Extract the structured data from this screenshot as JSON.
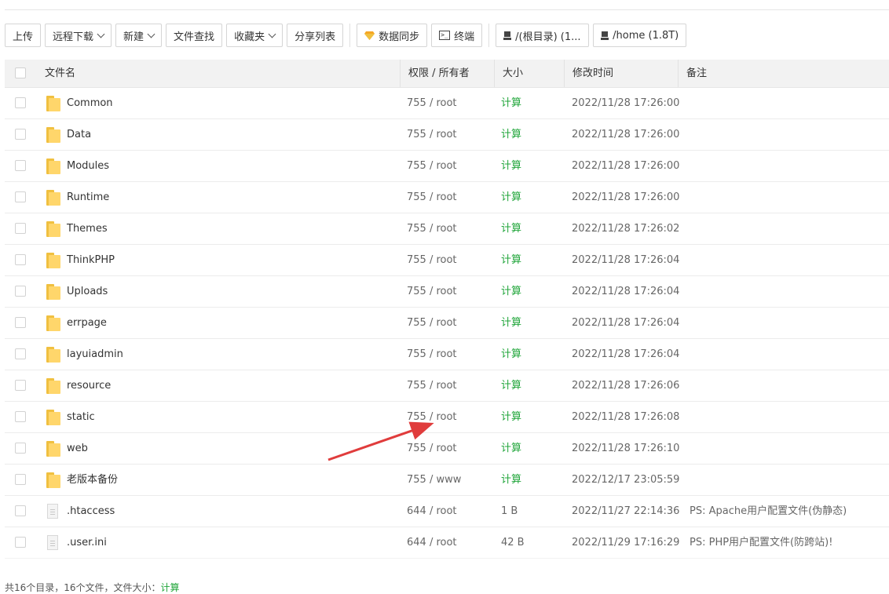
{
  "toolbar": {
    "buttons": [
      {
        "label": "上传",
        "caret": false
      },
      {
        "label": "远程下载",
        "caret": true
      },
      {
        "label": "新建",
        "caret": true
      },
      {
        "label": "文件查找",
        "caret": false
      },
      {
        "label": "收藏夹",
        "caret": true
      },
      {
        "label": "分享列表",
        "caret": false
      }
    ],
    "sync_label": "数据同步",
    "terminal_label": "终端",
    "disks": [
      "/(根目录) (1...",
      "/home (1.8T)"
    ]
  },
  "table": {
    "headers": {
      "name": "文件名",
      "perm": "权限 / 所有者",
      "size": "大小",
      "mtime": "修改时间",
      "note": "备注"
    },
    "rows": [
      {
        "type": "folder",
        "name": "Common",
        "perm": "755 / root",
        "size": "计算",
        "mtime": "2022/11/28 17:26:00",
        "note": ""
      },
      {
        "type": "folder",
        "name": "Data",
        "perm": "755 / root",
        "size": "计算",
        "mtime": "2022/11/28 17:26:00",
        "note": ""
      },
      {
        "type": "folder",
        "name": "Modules",
        "perm": "755 / root",
        "size": "计算",
        "mtime": "2022/11/28 17:26:00",
        "note": ""
      },
      {
        "type": "folder",
        "name": "Runtime",
        "perm": "755 / root",
        "size": "计算",
        "mtime": "2022/11/28 17:26:00",
        "note": ""
      },
      {
        "type": "folder",
        "name": "Themes",
        "perm": "755 / root",
        "size": "计算",
        "mtime": "2022/11/28 17:26:02",
        "note": ""
      },
      {
        "type": "folder",
        "name": "ThinkPHP",
        "perm": "755 / root",
        "size": "计算",
        "mtime": "2022/11/28 17:26:04",
        "note": ""
      },
      {
        "type": "folder",
        "name": "Uploads",
        "perm": "755 / root",
        "size": "计算",
        "mtime": "2022/11/28 17:26:04",
        "note": ""
      },
      {
        "type": "folder",
        "name": "errpage",
        "perm": "755 / root",
        "size": "计算",
        "mtime": "2022/11/28 17:26:04",
        "note": ""
      },
      {
        "type": "folder",
        "name": "layuiadmin",
        "perm": "755 / root",
        "size": "计算",
        "mtime": "2022/11/28 17:26:04",
        "note": ""
      },
      {
        "type": "folder",
        "name": "resource",
        "perm": "755 / root",
        "size": "计算",
        "mtime": "2022/11/28 17:26:06",
        "note": ""
      },
      {
        "type": "folder",
        "name": "static",
        "perm": "755 / root",
        "size": "计算",
        "mtime": "2022/11/28 17:26:08",
        "note": ""
      },
      {
        "type": "folder",
        "name": "web",
        "perm": "755 / root",
        "size": "计算",
        "mtime": "2022/11/28 17:26:10",
        "note": ""
      },
      {
        "type": "folder",
        "name": "老版本备份",
        "perm": "755 / www",
        "size": "计算",
        "mtime": "2022/12/17 23:05:59",
        "note": ""
      },
      {
        "type": "file",
        "name": ".htaccess",
        "perm": "644 / root",
        "size": "1 B",
        "mtime": "2022/11/27 22:14:36",
        "note": "PS: Apache用户配置文件(伪静态)"
      },
      {
        "type": "file",
        "name": ".user.ini",
        "perm": "644 / root",
        "size": "42 B",
        "mtime": "2022/11/29 17:16:29",
        "note": "PS: PHP用户配置文件(防跨站)!"
      }
    ]
  },
  "footer": {
    "text": "共16个目录，16个文件，文件大小：",
    "calc": "计算"
  },
  "colors": {
    "calc_green": "#20a53a",
    "annotation_arrow": "#e03c3c",
    "folder_yellow": "#ffd66b"
  }
}
